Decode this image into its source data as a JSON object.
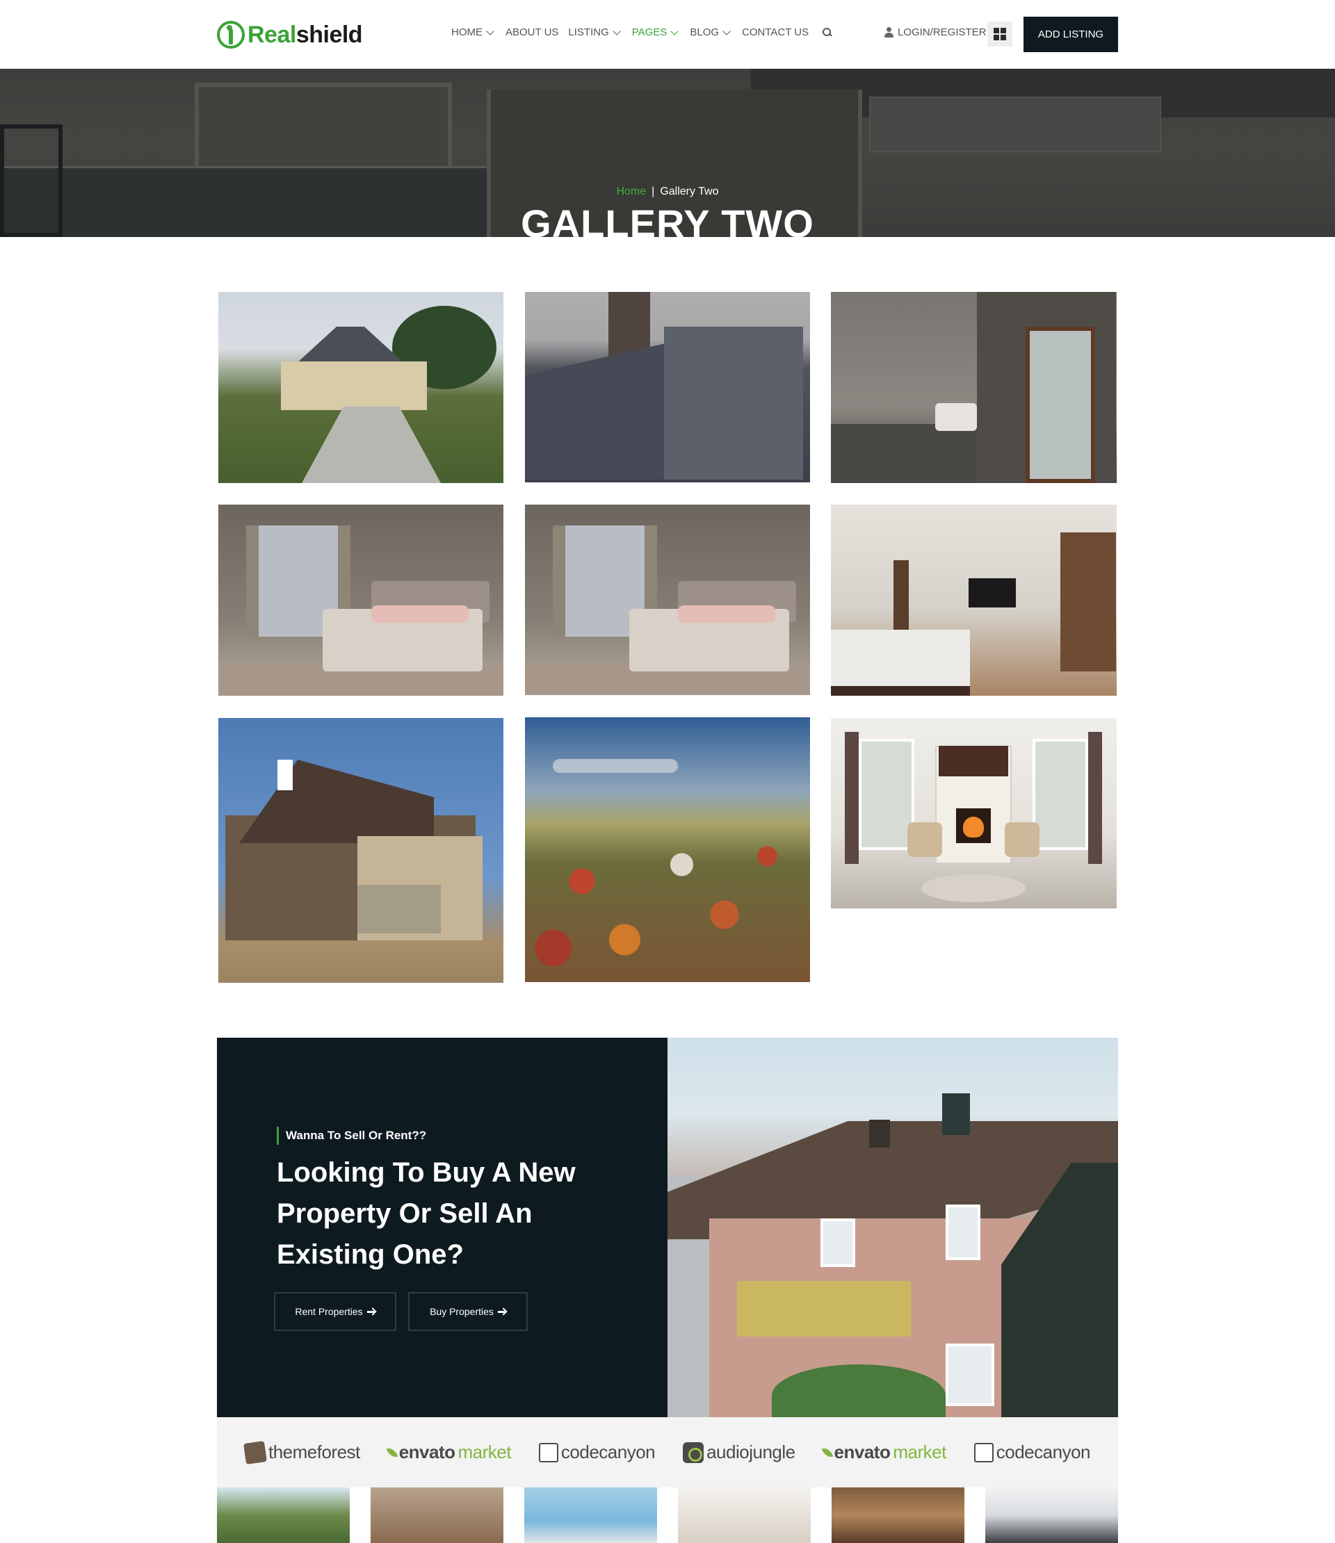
{
  "brand": {
    "name_part1": "Real",
    "name_part2": "shield",
    "primary_color": "#3aa335",
    "dark_color": "#0d1a20"
  },
  "nav": {
    "items": [
      {
        "label": "HOME",
        "has_dropdown": true,
        "active": false
      },
      {
        "label": "ABOUT US",
        "has_dropdown": false,
        "active": false
      },
      {
        "label": "LISTING",
        "has_dropdown": true,
        "active": false
      },
      {
        "label": "PAGES",
        "has_dropdown": true,
        "active": true
      },
      {
        "label": "BLOG",
        "has_dropdown": true,
        "active": false
      },
      {
        "label": "CONTACT US",
        "has_dropdown": false,
        "active": false
      }
    ],
    "search_icon": "search-icon"
  },
  "header": {
    "login_label": "LOGIN/REGISTER",
    "add_listing_label": "ADD LISTING"
  },
  "hero": {
    "breadcrumb_home": "Home",
    "breadcrumb_sep": "|",
    "breadcrumb_current": "Gallery Two",
    "title": "GALLERY TWO"
  },
  "gallery": {
    "images": [
      {
        "subject": "suburban house with driveway"
      },
      {
        "subject": "old town street buildings"
      },
      {
        "subject": "modern interior hallway"
      },
      {
        "subject": "bedroom with curtains"
      },
      {
        "subject": "bedroom with curtains"
      },
      {
        "subject": "modern bedroom with tv"
      },
      {
        "subject": "brown two-story house"
      },
      {
        "subject": "aerial view of village"
      },
      {
        "subject": "living room with fireplace"
      }
    ]
  },
  "cta": {
    "tagline": "Wanna To Sell Or Rent??",
    "title": "Looking To Buy A New Property Or Sell An Existing One?",
    "rent_button": "Rent Properties",
    "buy_button": "Buy Properties"
  },
  "partners": {
    "items": [
      {
        "name": "themeforest",
        "icon": "themeforest-icon"
      },
      {
        "name": "envato",
        "suffix": "market",
        "icon": "leaf-icon"
      },
      {
        "name": "codecanyon",
        "icon": "codecanyon-icon"
      },
      {
        "name": "audiojungle",
        "icon": "audiojungle-icon"
      },
      {
        "name": "envato",
        "suffix": "market",
        "icon": "leaf-icon"
      },
      {
        "name": "codecanyon",
        "icon": "codecanyon-icon"
      }
    ]
  }
}
